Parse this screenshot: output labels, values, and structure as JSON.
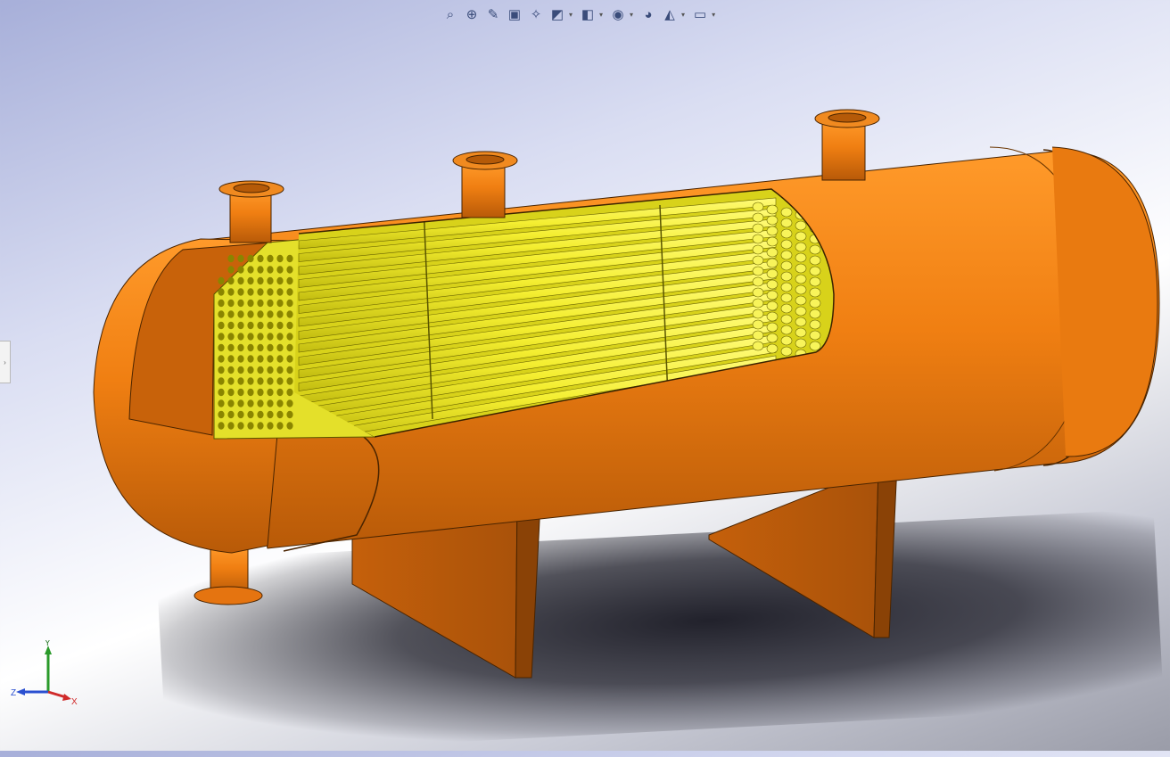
{
  "toolbar": {
    "buttons": [
      {
        "name": "zoom-to-fit",
        "glyph": "⌕"
      },
      {
        "name": "zoom-to-area",
        "glyph": "⊕"
      },
      {
        "name": "previous-view",
        "glyph": "✎"
      },
      {
        "name": "section-view",
        "glyph": "▣"
      },
      {
        "name": "dynamic-annotation",
        "glyph": "✧"
      },
      {
        "name": "view-orientation",
        "glyph": "◩"
      },
      {
        "name": "display-style",
        "glyph": "◧"
      },
      {
        "name": "hide-show-items",
        "glyph": "◉"
      },
      {
        "name": "edit-appearance",
        "glyph": "◕"
      },
      {
        "name": "apply-scene",
        "glyph": "◭"
      },
      {
        "name": "view-settings",
        "glyph": "▭"
      }
    ]
  },
  "triad": {
    "x_label": "X",
    "y_label": "Y",
    "z_label": "Z"
  },
  "colors": {
    "shell": "#f07f12",
    "shell_dark": "#a8520a",
    "tubes": "#f5f23a",
    "tubes_dark": "#b9b40f"
  }
}
